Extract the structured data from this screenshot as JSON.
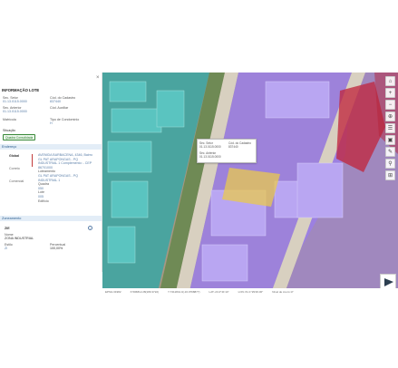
{
  "panel": {
    "title": "INFORMAÇÃO LOTE",
    "close": "×",
    "fields": {
      "sec_setor_label": "Sec. Setor",
      "sec_setor_value": "01.13.0115.0000",
      "cod_cadastro_label": "Cód. do Cadastro",
      "cod_cadastro_value": "837440",
      "sec_anterior_label": "Sec. Anterior",
      "sec_anterior_value": "01.13.0115.0000",
      "cod_auxiliar_label": "Cód. Auxiliar",
      "cod_auxiliar_value": "",
      "matricula_label": "Matrícula",
      "matricula_value": "",
      "tipo_condominio_label": "Tipo de Condomínio",
      "tipo_condominio_value": "H",
      "situacao_label": "Situação",
      "situacao_value": "Quadra Consolidada"
    },
    "endereco": {
      "header": "Endereço",
      "tabs": [
        "Global",
        "Correio",
        "Comercial"
      ],
      "lines": [
        "AVENIDA BARBACENA, 4346, Bairro",
        "GL PAT ARAPONGAS - PQ",
        "INDUSTRIAL 1 Complemento: - CEP",
        "86701000",
        "Loteamento",
        "GL PAT ARAPONGAS - PQ",
        "INDUSTRIAL 1",
        "Quadra",
        "050",
        "Lote",
        "005",
        "Edifício"
      ]
    },
    "zoneamento": {
      "header": "Zoneamento",
      "zone": "ZIE",
      "info": "i",
      "name_label": "Nome",
      "name_value": "ZONA INDUSTRIAL",
      "estilo_label": "Estilo",
      "estilo_value": "ZI",
      "percentual_label": "Percentual",
      "percentual_value": "100,00%"
    }
  },
  "map": {
    "popup": {
      "sec_setor_label": "Sec. Setor",
      "sec_setor_value": "01.13.0115.0000",
      "cod_label": "Cód. do Cadastro",
      "cod_value": "837440",
      "sec_anterior_label": "Sec. Anterior",
      "sec_anterior_value": "01.13.0115.0000"
    },
    "controls": [
      "⌂",
      "+",
      "−",
      "⊕",
      "☰",
      "▣",
      "✎",
      "⚲",
      "⊞",
      "◎",
      "⟳",
      "✆"
    ],
    "status": [
      "EPSG:31982",
      "X:506812.28(180.3722)",
      "Y:7411841.0(-16.0768877)",
      "LAT:-23.2°41'14\"",
      "LON:-51.1°29'26.00\"",
      "Nível de zoom:17"
    ]
  },
  "colors": {
    "zone_industrial": "#9b7fe6",
    "zone_teal": "#4ec3c0",
    "zone_red": "#c0283f",
    "zone_yellow": "#e9c84f",
    "road": "#d8d0c0"
  }
}
